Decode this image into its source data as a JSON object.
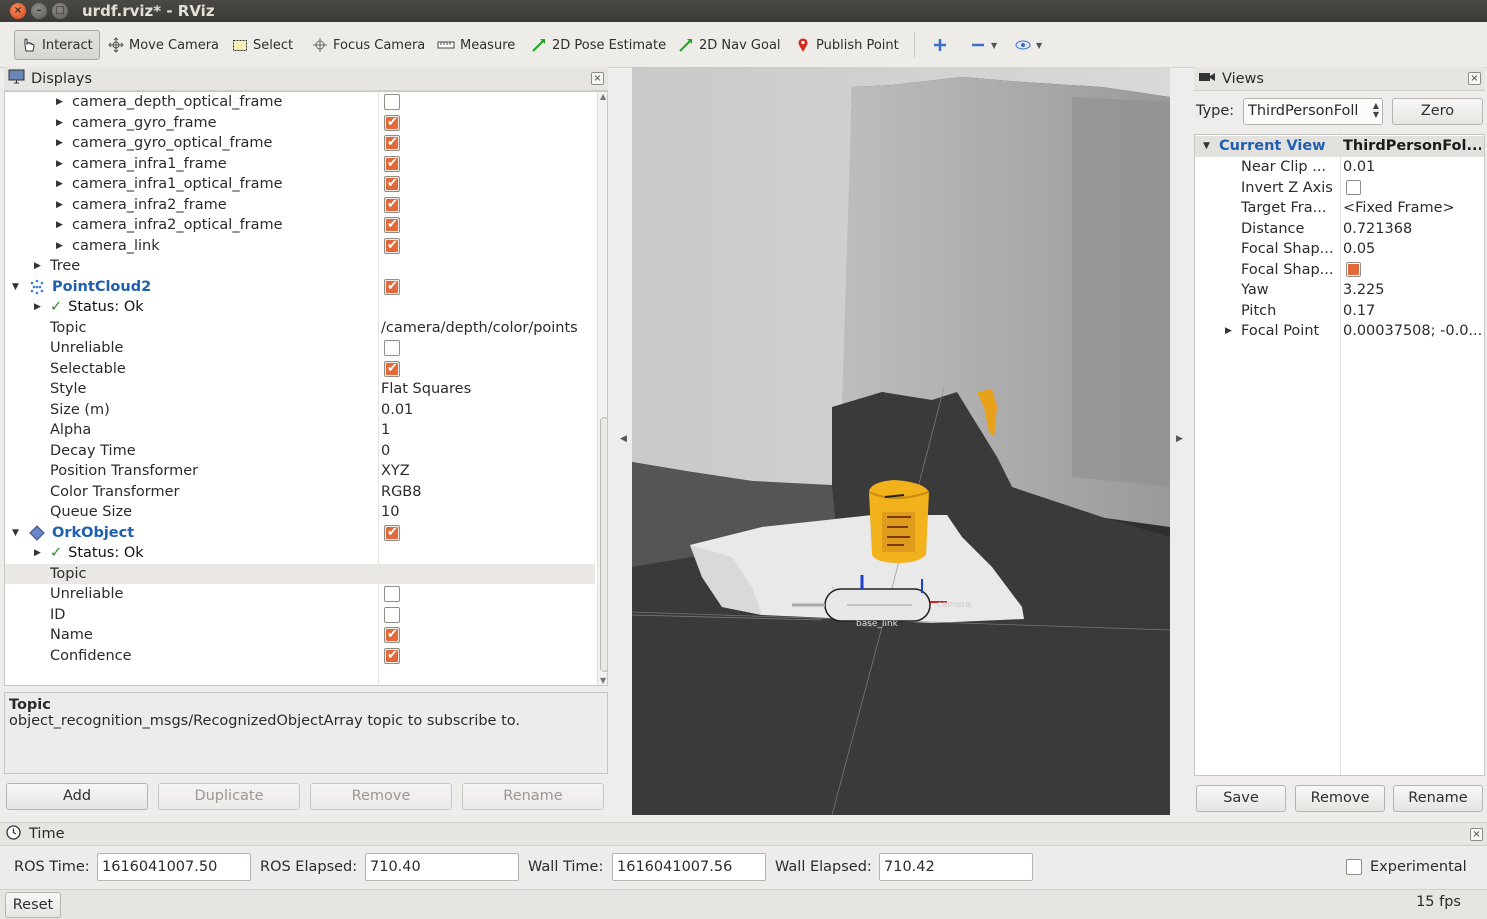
{
  "window": {
    "title": "urdf.rviz* - RViz"
  },
  "toolbar": {
    "tools": [
      {
        "label": "Interact",
        "icon": "hand-icon"
      },
      {
        "label": "Move Camera",
        "icon": "move-camera-icon"
      },
      {
        "label": "Select",
        "icon": "select-icon"
      },
      {
        "label": "Focus Camera",
        "icon": "focus-camera-icon"
      },
      {
        "label": "Measure",
        "icon": "measure-icon"
      },
      {
        "label": "2D Pose Estimate",
        "icon": "green-arrow-icon"
      },
      {
        "label": "2D Nav Goal",
        "icon": "green-arrow-icon"
      },
      {
        "label": "Publish Point",
        "icon": "map-pin-icon"
      }
    ],
    "active_tool": "Interact"
  },
  "displays": {
    "title": "Displays",
    "rows": [
      {
        "label": "camera_depth_optical_frame",
        "checked": false
      },
      {
        "label": "camera_gyro_frame",
        "checked": true
      },
      {
        "label": "camera_gyro_optical_frame",
        "checked": true
      },
      {
        "label": "camera_infra1_frame",
        "checked": true
      },
      {
        "label": "camera_infra1_optical_frame",
        "checked": true
      },
      {
        "label": "camera_infra2_frame",
        "checked": true
      },
      {
        "label": "camera_infra2_optical_frame",
        "checked": true
      },
      {
        "label": "camera_link",
        "checked": true
      },
      {
        "label": "Tree"
      },
      {
        "label": "PointCloud2",
        "checked": true
      },
      {
        "label": "Status: Ok"
      },
      {
        "label": "Topic",
        "value": "/camera/depth/color/points"
      },
      {
        "label": "Unreliable",
        "checked": false
      },
      {
        "label": "Selectable",
        "checked": true
      },
      {
        "label": "Style",
        "value": "Flat Squares"
      },
      {
        "label": "Size (m)",
        "value": "0.01"
      },
      {
        "label": "Alpha",
        "value": "1"
      },
      {
        "label": "Decay Time",
        "value": "0"
      },
      {
        "label": "Position Transformer",
        "value": "XYZ"
      },
      {
        "label": "Color Transformer",
        "value": "RGB8"
      },
      {
        "label": "Queue Size",
        "value": "10"
      },
      {
        "label": "OrkObject",
        "checked": true
      },
      {
        "label": "Status: Ok"
      },
      {
        "label": "Topic",
        "value": ""
      },
      {
        "label": "Unreliable",
        "checked": false
      },
      {
        "label": "ID",
        "checked": false
      },
      {
        "label": "Name",
        "checked": true
      },
      {
        "label": "Confidence",
        "checked": true
      }
    ],
    "description": {
      "title": "Topic",
      "text": "object_recognition_msgs/RecognizedObjectArray topic to subscribe to."
    },
    "buttons": {
      "add": "Add",
      "duplicate": "Duplicate",
      "remove": "Remove",
      "rename": "Rename"
    }
  },
  "viewport": {
    "labels": {
      "base_link": "base_link",
      "frame": "camera"
    }
  },
  "views": {
    "title": "Views",
    "type_label": "Type:",
    "type_value": "ThirdPersonFoll",
    "zero_button": "Zero",
    "header": {
      "label": "Current View",
      "value": "ThirdPersonFol..."
    },
    "rows": [
      {
        "label": "Near Clip ...",
        "value": "0.01"
      },
      {
        "label": "Invert Z Axis",
        "checked": false
      },
      {
        "label": "Target Fra...",
        "value": "<Fixed Frame>"
      },
      {
        "label": "Distance",
        "value": "0.721368"
      },
      {
        "label": "Focal Shap...",
        "value": "0.05"
      },
      {
        "label": "Focal Shap...",
        "checked": true
      },
      {
        "label": "Yaw",
        "value": "3.225"
      },
      {
        "label": "Pitch",
        "value": "0.17"
      },
      {
        "label": "Focal Point",
        "value": "0.00037508; -0.0..."
      }
    ],
    "buttons": {
      "save": "Save",
      "remove": "Remove",
      "rename": "Rename"
    }
  },
  "time": {
    "title": "Time",
    "ros_time_label": "ROS Time:",
    "ros_time": "1616041007.50",
    "ros_elapsed_label": "ROS Elapsed:",
    "ros_elapsed": "710.40",
    "wall_time_label": "Wall Time:",
    "wall_time": "1616041007.56",
    "wall_elapsed_label": "Wall Elapsed:",
    "wall_elapsed": "710.42",
    "experimental_label": "Experimental",
    "reset_button": "Reset",
    "fps": "15 fps"
  },
  "colors": {
    "checkbox_on": "#e26a3a",
    "display_name": "#1f5fb0",
    "status_ok": "#2e8b2e",
    "viewport_bg": "#303030"
  }
}
